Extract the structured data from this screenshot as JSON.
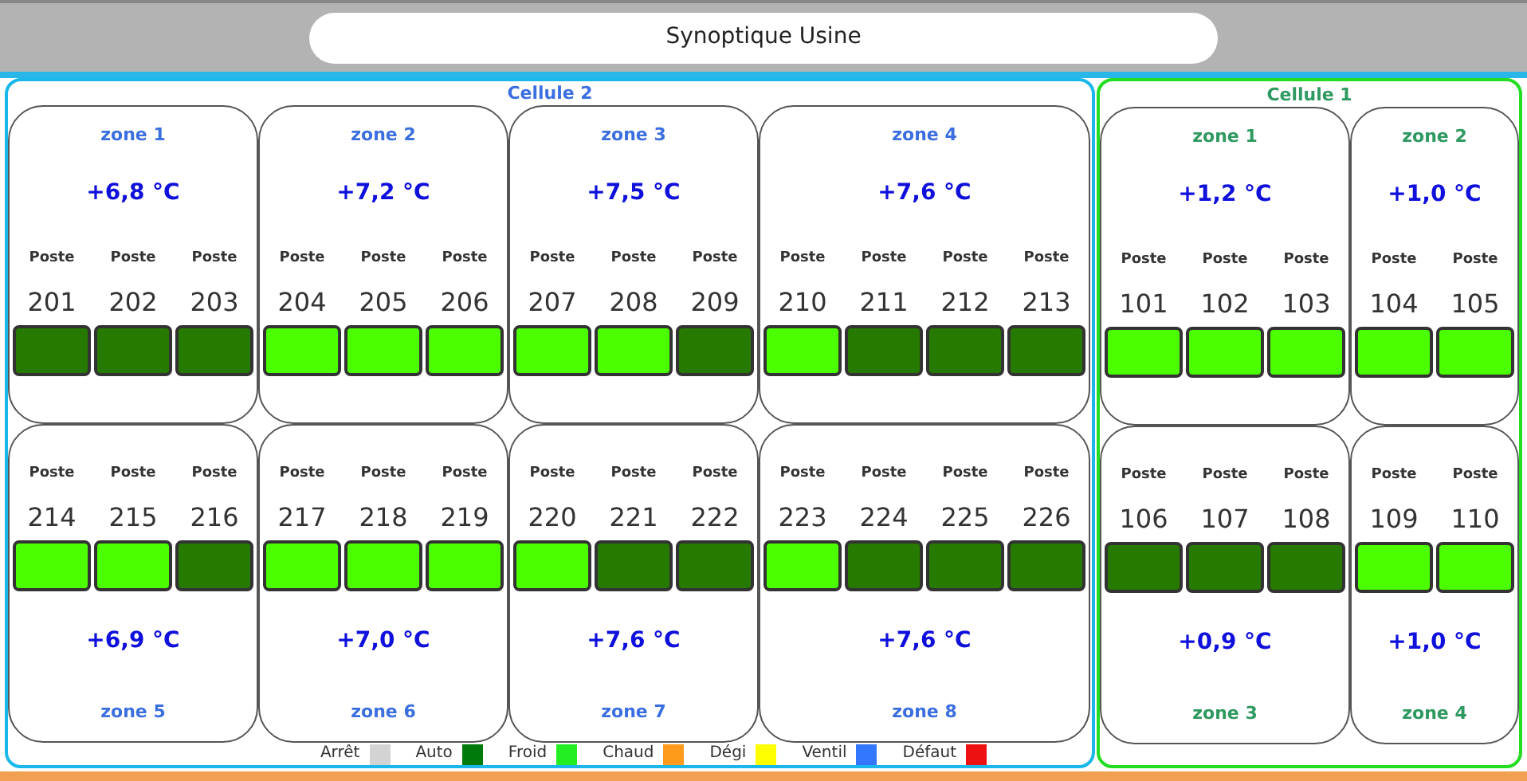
{
  "title": "Synoptique Usine",
  "cellules": [
    {
      "title": "Cellule 2",
      "color": "#1ab8ea",
      "rows": [
        {
          "kind": "header_first",
          "zones": [
            {
              "name": "zone 1",
              "temperature": "+6,8 °C",
              "postes": [
                {
                  "label": "Poste",
                  "number": "201",
                  "color": "#267a00"
                },
                {
                  "label": "Poste",
                  "number": "202",
                  "color": "#267a00"
                },
                {
                  "label": "Poste",
                  "number": "203",
                  "color": "#267a00"
                }
              ]
            },
            {
              "name": "zone 2",
              "temperature": "+7,2 °C",
              "postes": [
                {
                  "label": "Poste",
                  "number": "204",
                  "color": "#4cff00"
                },
                {
                  "label": "Poste",
                  "number": "205",
                  "color": "#4cff00"
                },
                {
                  "label": "Poste",
                  "number": "206",
                  "color": "#4cff00"
                }
              ]
            },
            {
              "name": "zone 3",
              "temperature": "+7,5 °C",
              "postes": [
                {
                  "label": "Poste",
                  "number": "207",
                  "color": "#4cff00"
                },
                {
                  "label": "Poste",
                  "number": "208",
                  "color": "#4cff00"
                },
                {
                  "label": "Poste",
                  "number": "209",
                  "color": "#267a00"
                }
              ]
            },
            {
              "name": "zone 4",
              "temperature": "+7,6 °C",
              "postes": [
                {
                  "label": "Poste",
                  "number": "210",
                  "color": "#4cff00"
                },
                {
                  "label": "Poste",
                  "number": "211",
                  "color": "#267a00"
                },
                {
                  "label": "Poste",
                  "number": "212",
                  "color": "#267a00"
                },
                {
                  "label": "Poste",
                  "number": "213",
                  "color": "#267a00"
                }
              ]
            }
          ]
        },
        {
          "kind": "header_last",
          "zones": [
            {
              "name": "zone 5",
              "temperature": "+6,9 °C",
              "postes": [
                {
                  "label": "Poste",
                  "number": "214",
                  "color": "#4cff00"
                },
                {
                  "label": "Poste",
                  "number": "215",
                  "color": "#4cff00"
                },
                {
                  "label": "Poste",
                  "number": "216",
                  "color": "#267a00"
                }
              ]
            },
            {
              "name": "zone 6",
              "temperature": "+7,0 °C",
              "postes": [
                {
                  "label": "Poste",
                  "number": "217",
                  "color": "#4cff00"
                },
                {
                  "label": "Poste",
                  "number": "218",
                  "color": "#4cff00"
                },
                {
                  "label": "Poste",
                  "number": "219",
                  "color": "#4cff00"
                }
              ]
            },
            {
              "name": "zone 7",
              "temperature": "+7,6 °C",
              "postes": [
                {
                  "label": "Poste",
                  "number": "220",
                  "color": "#4cff00"
                },
                {
                  "label": "Poste",
                  "number": "221",
                  "color": "#267a00"
                },
                {
                  "label": "Poste",
                  "number": "222",
                  "color": "#267a00"
                }
              ]
            },
            {
              "name": "zone 8",
              "temperature": "+7,6 °C",
              "postes": [
                {
                  "label": "Poste",
                  "number": "223",
                  "color": "#4cff00"
                },
                {
                  "label": "Poste",
                  "number": "224",
                  "color": "#267a00"
                },
                {
                  "label": "Poste",
                  "number": "225",
                  "color": "#267a00"
                },
                {
                  "label": "Poste",
                  "number": "226",
                  "color": "#267a00"
                }
              ]
            }
          ]
        }
      ]
    },
    {
      "title": "Cellule 1",
      "color": "#22dd22",
      "rows": [
        {
          "kind": "header_first",
          "zones": [
            {
              "name": "zone 1",
              "temperature": "+1,2 °C",
              "postes": [
                {
                  "label": "Poste",
                  "number": "101",
                  "color": "#4cff00"
                },
                {
                  "label": "Poste",
                  "number": "102",
                  "color": "#4cff00"
                },
                {
                  "label": "Poste",
                  "number": "103",
                  "color": "#4cff00"
                }
              ]
            },
            {
              "name": "zone 2",
              "temperature": "+1,0 °C",
              "postes": [
                {
                  "label": "Poste",
                  "number": "104",
                  "color": "#4cff00"
                },
                {
                  "label": "Poste",
                  "number": "105",
                  "color": "#4cff00"
                }
              ]
            }
          ]
        },
        {
          "kind": "header_last",
          "zones": [
            {
              "name": "zone 3",
              "temperature": "+0,9 °C",
              "postes": [
                {
                  "label": "Poste",
                  "number": "106",
                  "color": "#267a00"
                },
                {
                  "label": "Poste",
                  "number": "107",
                  "color": "#267a00"
                },
                {
                  "label": "Poste",
                  "number": "108",
                  "color": "#267a00"
                }
              ]
            },
            {
              "name": "zone 4",
              "temperature": "+1,0 °C",
              "postes": [
                {
                  "label": "Poste",
                  "number": "109",
                  "color": "#4cff00"
                },
                {
                  "label": "Poste",
                  "number": "110",
                  "color": "#4cff00"
                }
              ]
            }
          ]
        }
      ]
    }
  ],
  "legend": [
    {
      "label": "Arrêt",
      "color": "#d3d3d3"
    },
    {
      "label": "Auto",
      "color": "#007a0a"
    },
    {
      "label": "Froid",
      "color": "#22ee22"
    },
    {
      "label": "Chaud",
      "color": "#ff9a1a"
    },
    {
      "label": "Dégi",
      "color": "#ffff00"
    },
    {
      "label": "Ventil",
      "color": "#3377ff"
    },
    {
      "label": "Défaut",
      "color": "#ee1111"
    }
  ]
}
